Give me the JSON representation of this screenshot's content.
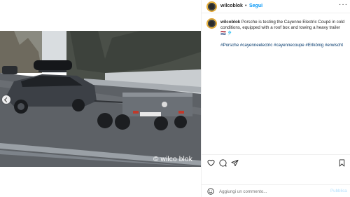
{
  "post": {
    "username": "wilcoblok",
    "separator": "•",
    "follow_label": "Segui",
    "more_label": "···",
    "caption_user": "wilcoblok",
    "caption_text": " Porsche is testing the Cayenne Electric Coupé in cold conditions, equipped with a roof box and towing a heavy trailer 🇳🇱 🎐",
    "hashtags": "#Porsche #cayenneelectric #cayennecoupe #Erlkönig #erwischt",
    "watermark": "© wilco blok"
  },
  "comment": {
    "placeholder": "Aggiungi un commento...",
    "publish_label": "Pubblica"
  },
  "colors": {
    "link": "#0095f6",
    "hashtag": "#00376b",
    "publish_disabled": "#b2dffc"
  },
  "icons": [
    "chevron-left-icon",
    "heart-icon",
    "comment-icon",
    "share-icon",
    "bookmark-icon",
    "emoji-icon",
    "more-icon"
  ]
}
